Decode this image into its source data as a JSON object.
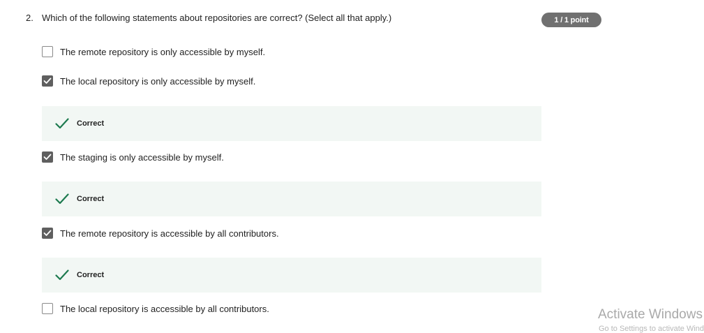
{
  "question": {
    "number": "2.",
    "text": "Which of the following statements about repositories are correct? (Select all that apply.)",
    "points": "1 / 1 point"
  },
  "colors": {
    "badge_bg": "#707070",
    "feedback_bg": "#f2f7f4",
    "correct_check": "#1d7a4f",
    "checkbox_checked": "#5f5f5f"
  },
  "options": [
    {
      "label": "The remote repository is only accessible by myself.",
      "checked": false
    },
    {
      "label": "The local repository is only accessible by myself.",
      "checked": true,
      "feedback": "Correct"
    },
    {
      "label": "The staging is only accessible by myself.",
      "checked": true,
      "feedback": "Correct"
    },
    {
      "label": "The remote repository is accessible by all contributors.",
      "checked": true,
      "feedback": "Correct"
    },
    {
      "label": "The local repository is accessible by all contributors.",
      "checked": false
    }
  ],
  "os_watermark": {
    "title": "Activate Windows",
    "subtitle": "Go to Settings to activate Windows."
  }
}
